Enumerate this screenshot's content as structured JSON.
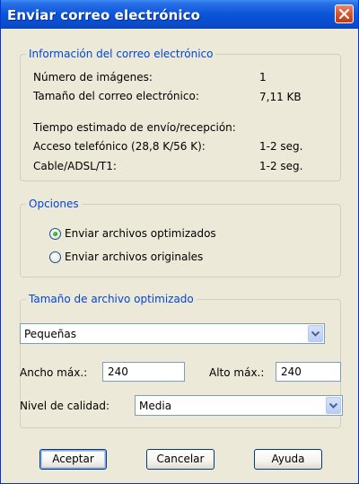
{
  "window": {
    "title": "Enviar correo electrónico",
    "close_icon": "close-icon"
  },
  "info": {
    "legend": "Información del correo electrónico",
    "num_images_label": "Número de imágenes:",
    "num_images_value": "1",
    "size_label": "Tamaño del correo electrónico:",
    "size_value": "7,11 KB",
    "est_time_label": "Tiempo estimado de envío/recepción:",
    "dialup_label": "Acceso telefónico (28,8 K/56 K):",
    "dialup_value": "1-2 seg.",
    "cable_label": "Cable/ADSL/T1:",
    "cable_value": "1-2 seg."
  },
  "options": {
    "legend": "Opciones",
    "items": [
      {
        "label": "Enviar archivos optimizados",
        "selected": true
      },
      {
        "label": "Enviar archivos originales",
        "selected": false
      }
    ]
  },
  "optimized": {
    "legend": "Tamaño de archivo optimizado",
    "size_preset": "Pequeñas",
    "width_label": "Ancho máx.:",
    "width_value": "240",
    "height_label": "Alto máx.:",
    "height_value": "240",
    "quality_label": "Nivel de calidad:",
    "quality_value": "Media"
  },
  "buttons": {
    "ok": "Aceptar",
    "cancel": "Cancelar",
    "help": "Ayuda"
  },
  "colors": {
    "titlebar": "#0a55d8",
    "dialog_bg": "#ece9d8",
    "legend_text": "#0046d5",
    "close_button": "#d9532b"
  }
}
